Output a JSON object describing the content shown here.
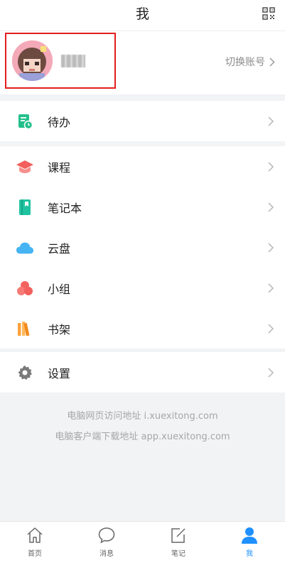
{
  "header": {
    "title": "我"
  },
  "profile": {
    "switch_label": "切换账号"
  },
  "menu": {
    "todo": "待办",
    "courses": "课程",
    "notebook": "笔记本",
    "cloud": "云盘",
    "group": "小组",
    "bookshelf": "书架",
    "settings": "设置"
  },
  "footer": {
    "web_line": "电脑网页访问地址 i.xuexitong.com",
    "download_line": "电脑客户端下载地址 app.xuexitong.com"
  },
  "tabs": [
    {
      "label": "首页",
      "icon": "home-icon"
    },
    {
      "label": "消息",
      "icon": "message-icon"
    },
    {
      "label": "笔记",
      "icon": "note-icon"
    },
    {
      "label": "我",
      "icon": "user-icon"
    }
  ],
  "colors": {
    "accent": "#1e90ff",
    "todo": "#23c08c",
    "courses": "#f25f5c",
    "notebook": "#1fc3a0",
    "cloud": "#46b4f3",
    "group": "#f4645f",
    "bookshelf": "#ffa23b",
    "settings": "#7a7a7a",
    "highlight": "#e31d1d"
  }
}
